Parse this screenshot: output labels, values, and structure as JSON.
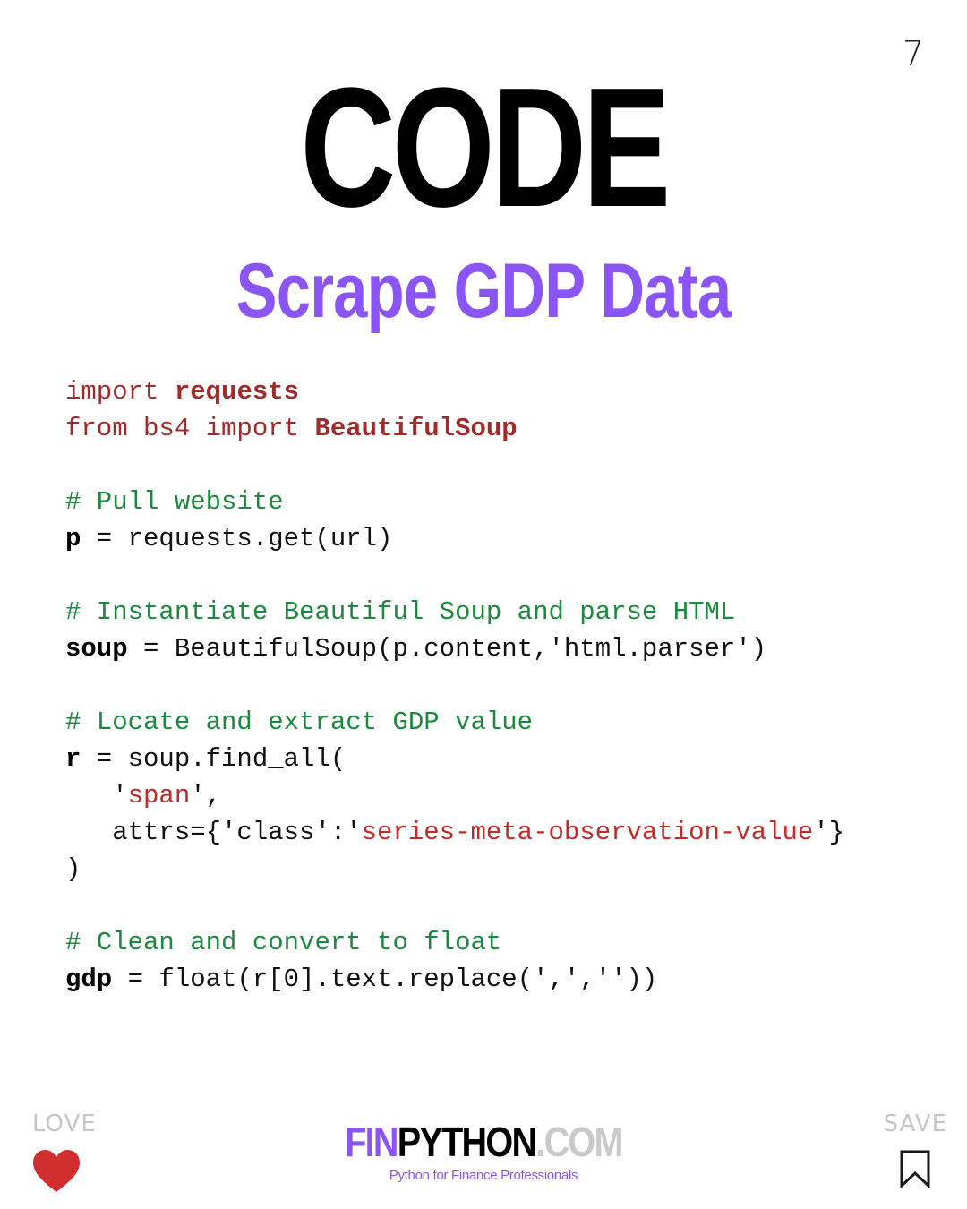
{
  "page_number": "7",
  "title": "CODE",
  "subtitle": "Scrape GDP Data",
  "code": {
    "line1": {
      "kw": "import ",
      "mod": "requests"
    },
    "line2": {
      "kw1": "from bs4 import ",
      "mod": "BeautifulSoup"
    },
    "c1": "# Pull website",
    "line3": {
      "var": "p",
      "rest": " = requests.get(url)"
    },
    "c2": "# Instantiate Beautiful Soup and parse HTML",
    "line4": {
      "var": "soup",
      "rest": " = BeautifulSoup(p.content,'html.parser')"
    },
    "c3": "# Locate and extract GDP value",
    "line5": {
      "var": "r",
      "rest": " = soup.find_all("
    },
    "line6": {
      "indent": "   '",
      "str": "span",
      "rest": "',"
    },
    "line7": {
      "indent": "   attrs={'class':'",
      "str": "series-meta-observation-value",
      "rest": "'}"
    },
    "line8": ")",
    "c4": "# Clean and convert to float",
    "line9": {
      "var": "gdp",
      "rest": " = float(r[0].text.replace(',',''))"
    }
  },
  "footer": {
    "love_label": "LOVE",
    "save_label": "SAVE",
    "brand_fin": "FIN",
    "brand_python": "PYTHON",
    "brand_com": ".COM",
    "tagline": "Python for Finance Professionals"
  },
  "colors": {
    "accent": "#8b55f5",
    "keyword": "#a12b2b",
    "comment": "#1c8a3e",
    "string": "#c22a2a",
    "heart": "#d12f2f"
  },
  "icons": [
    "heart-icon",
    "bookmark-icon"
  ]
}
